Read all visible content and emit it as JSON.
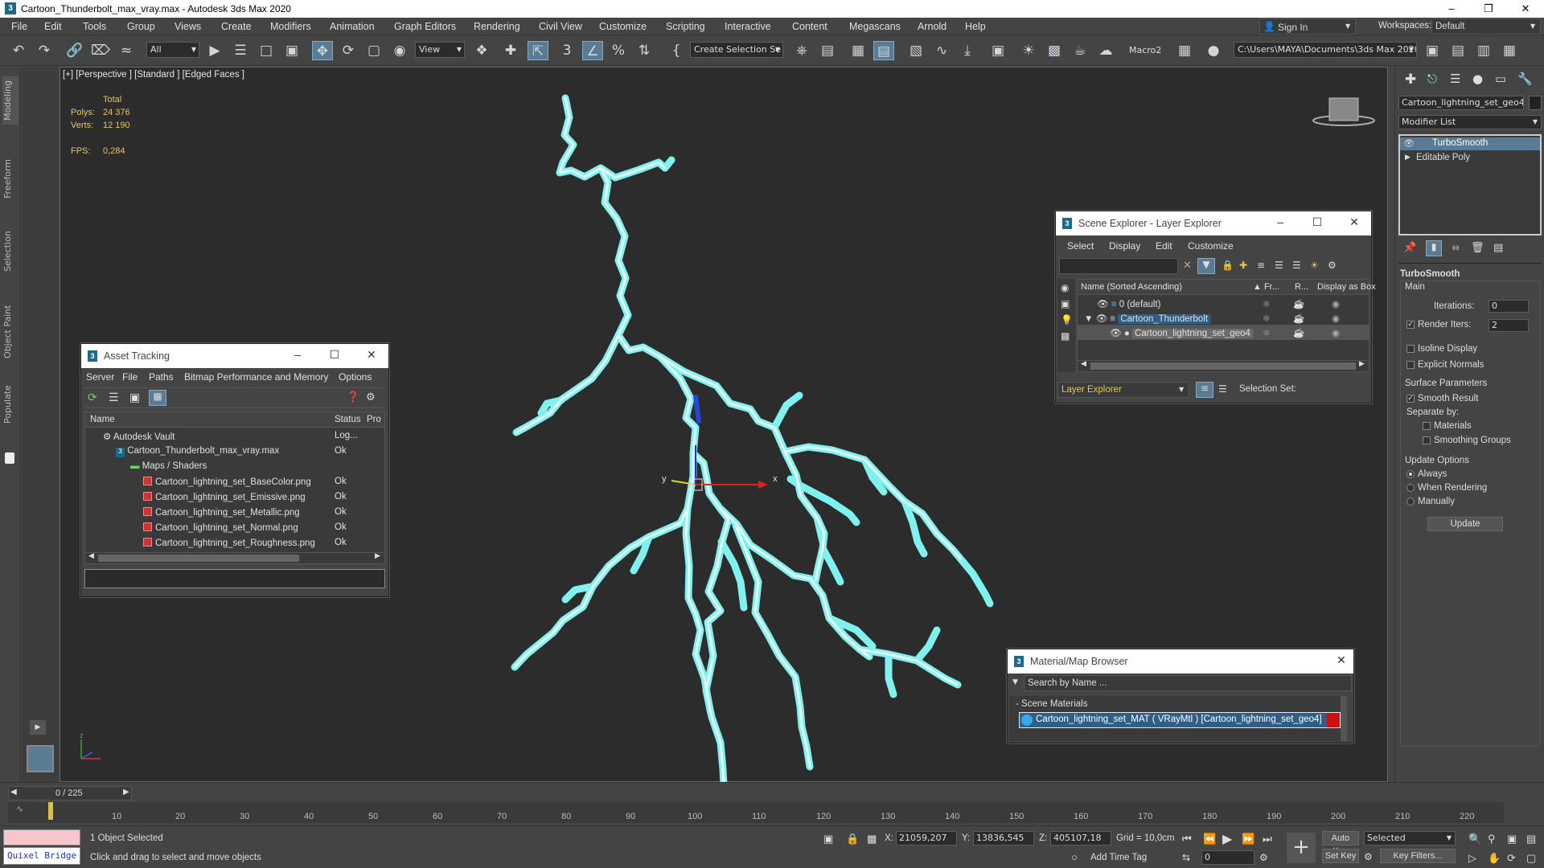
{
  "window": {
    "title": "Cartoon_Thunderbolt_max_vray.max - Autodesk 3ds Max 2020",
    "app_icon": "3"
  },
  "menu": [
    "File",
    "Edit",
    "Tools",
    "Group",
    "Views",
    "Create",
    "Modifiers",
    "Animation",
    "Graph Editors",
    "Rendering",
    "Civil View",
    "Customize",
    "Scripting",
    "Interactive",
    "Content",
    "Megascans",
    "Arnold",
    "Help"
  ],
  "account": {
    "sign_in": "Sign In",
    "workspaces_label": "Workspaces:",
    "workspace": "Default"
  },
  "toolbar": {
    "filter": "All",
    "ref_coord": "View",
    "selection_set": "Create Selection Se",
    "macro": "Macro2",
    "project_path": "C:\\Users\\MAYA\\Documents\\3ds Max 2020"
  },
  "ribbon_tabs": [
    "Modeling",
    "Freeform",
    "Selection",
    "Object Paint",
    "Populate"
  ],
  "viewport": {
    "label": "[+] [Perspective ] [Standard ] [Edged Faces ]",
    "stats": {
      "total_label": "Total",
      "polys_label": "Polys:",
      "polys": "24 376",
      "verts_label": "Verts:",
      "verts": "12 190",
      "fps_label": "FPS:",
      "fps": "0,284"
    },
    "axis_x": "x",
    "axis_y": "y",
    "axis_z": "z"
  },
  "asset_tracking": {
    "title": "Asset Tracking",
    "menu": [
      "Server",
      "File",
      "Paths",
      "Bitmap Performance and Memory",
      "Options"
    ],
    "columns": [
      "Name",
      "Status",
      "Pro"
    ],
    "rows": [
      {
        "name": "Autodesk Vault",
        "status": "Log..."
      },
      {
        "name": "Cartoon_Thunderbolt_max_vray.max",
        "status": "Ok"
      },
      {
        "name": "Maps / Shaders",
        "status": ""
      },
      {
        "name": "Cartoon_lightning_set_BaseColor.png",
        "status": "Ok"
      },
      {
        "name": "Cartoon_lightning_set_Emissive.png",
        "status": "Ok"
      },
      {
        "name": "Cartoon_lightning_set_Metallic.png",
        "status": "Ok"
      },
      {
        "name": "Cartoon_lightning_set_Normal.png",
        "status": "Ok"
      },
      {
        "name": "Cartoon_lightning_set_Roughness.png",
        "status": "Ok"
      }
    ]
  },
  "scene_explorer": {
    "title": "Scene Explorer - Layer Explorer",
    "menu": [
      "Select",
      "Display",
      "Edit",
      "Customize"
    ],
    "columns": [
      "Name (Sorted Ascending)",
      "▲ Fr...",
      "R...",
      "Display as Box"
    ],
    "rows": [
      {
        "name": "0 (default)"
      },
      {
        "name": "Cartoon_Thunderbolt"
      },
      {
        "name": "Cartoon_lightning_set_geo4"
      }
    ],
    "mode": "Layer Explorer",
    "selection_set": "Selection Set:"
  },
  "material_browser": {
    "title": "Material/Map Browser",
    "search": "Search by Name ...",
    "group": "- Scene Materials",
    "material": "Cartoon_lightning_set_MAT ( VRayMtl ) [Cartoon_lightning_set_geo4]"
  },
  "command_panel": {
    "object_name": "Cartoon_lightning_set_geo4",
    "modifier_list": "Modifier List",
    "stack": [
      "TurboSmooth",
      "Editable Poly"
    ],
    "rollout": "TurboSmooth",
    "main": "Main",
    "iterations_label": "Iterations:",
    "iterations": "0",
    "render_iters_label": "Render Iters:",
    "render_iters": "2",
    "isoline": "Isoline Display",
    "explicit_normals": "Explicit Normals",
    "surface_params": "Surface Parameters",
    "smooth_result": "Smooth Result",
    "separate_by": "Separate by:",
    "materials": "Materials",
    "smoothing_groups": "Smoothing Groups",
    "update_options": "Update Options",
    "always": "Always",
    "when_rendering": "When Rendering",
    "manually": "Manually",
    "update": "Update"
  },
  "timeline": {
    "frame": "0 / 225",
    "ticks": [
      "10",
      "20",
      "30",
      "40",
      "50",
      "60",
      "70",
      "80",
      "90",
      "100",
      "110",
      "120",
      "130",
      "140",
      "150",
      "160",
      "170",
      "180",
      "190",
      "200",
      "210",
      "220"
    ]
  },
  "status": {
    "quixel": "Quixel Bridge",
    "selected": "1 Object Selected",
    "prompt": "Click and drag to select and move objects",
    "x_label": "X:",
    "x": "21059,207",
    "y_label": "Y:",
    "y": "13836,545",
    "z_label": "Z:",
    "z": "405107,18",
    "grid": "Grid = 10,0cm",
    "add_time_tag": "Add Time Tag",
    "auto_key": "Auto Key",
    "set_key": "Set Key",
    "key_mode": "Selected",
    "key_filters": "Key Filters...",
    "frame_field": "0"
  },
  "colors": {
    "lightning": "#7ff2f0",
    "accent": "#5a7b94",
    "highlight": "#2f5f86",
    "red": "#cc1111"
  }
}
